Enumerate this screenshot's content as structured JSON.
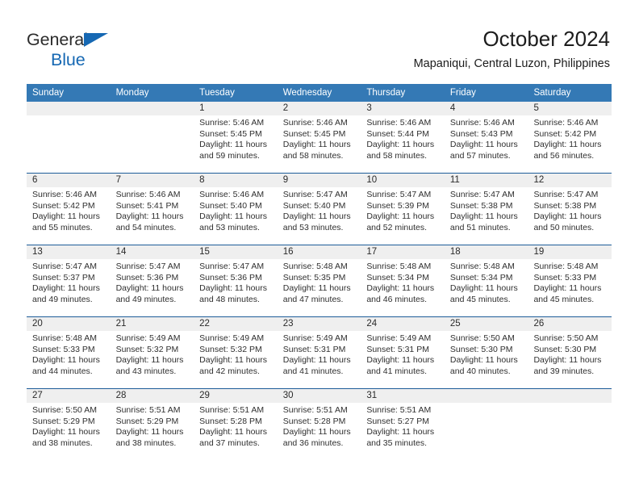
{
  "brand": {
    "word1": "General",
    "word2": "Blue",
    "triangle_color": "#1668b3",
    "text_color": "#2b2b2b"
  },
  "header": {
    "title": "October 2024",
    "subtitle": "Mapaniqui, Central Luzon, Philippines"
  },
  "theme": {
    "header_blue": "#3479b5",
    "divider_blue": "#1d5d99",
    "daynum_band": "#efefef",
    "cell_bg": "#ffffff"
  },
  "weekdays": [
    "Sunday",
    "Monday",
    "Tuesday",
    "Wednesday",
    "Thursday",
    "Friday",
    "Saturday"
  ],
  "weeks": [
    [
      {
        "day": "",
        "sunrise": "",
        "sunset": "",
        "daylight1": "",
        "daylight2": ""
      },
      {
        "day": "",
        "sunrise": "",
        "sunset": "",
        "daylight1": "",
        "daylight2": ""
      },
      {
        "day": "1",
        "sunrise": "Sunrise: 5:46 AM",
        "sunset": "Sunset: 5:45 PM",
        "daylight1": "Daylight: 11 hours",
        "daylight2": "and 59 minutes."
      },
      {
        "day": "2",
        "sunrise": "Sunrise: 5:46 AM",
        "sunset": "Sunset: 5:45 PM",
        "daylight1": "Daylight: 11 hours",
        "daylight2": "and 58 minutes."
      },
      {
        "day": "3",
        "sunrise": "Sunrise: 5:46 AM",
        "sunset": "Sunset: 5:44 PM",
        "daylight1": "Daylight: 11 hours",
        "daylight2": "and 58 minutes."
      },
      {
        "day": "4",
        "sunrise": "Sunrise: 5:46 AM",
        "sunset": "Sunset: 5:43 PM",
        "daylight1": "Daylight: 11 hours",
        "daylight2": "and 57 minutes."
      },
      {
        "day": "5",
        "sunrise": "Sunrise: 5:46 AM",
        "sunset": "Sunset: 5:42 PM",
        "daylight1": "Daylight: 11 hours",
        "daylight2": "and 56 minutes."
      }
    ],
    [
      {
        "day": "6",
        "sunrise": "Sunrise: 5:46 AM",
        "sunset": "Sunset: 5:42 PM",
        "daylight1": "Daylight: 11 hours",
        "daylight2": "and 55 minutes."
      },
      {
        "day": "7",
        "sunrise": "Sunrise: 5:46 AM",
        "sunset": "Sunset: 5:41 PM",
        "daylight1": "Daylight: 11 hours",
        "daylight2": "and 54 minutes."
      },
      {
        "day": "8",
        "sunrise": "Sunrise: 5:46 AM",
        "sunset": "Sunset: 5:40 PM",
        "daylight1": "Daylight: 11 hours",
        "daylight2": "and 53 minutes."
      },
      {
        "day": "9",
        "sunrise": "Sunrise: 5:47 AM",
        "sunset": "Sunset: 5:40 PM",
        "daylight1": "Daylight: 11 hours",
        "daylight2": "and 53 minutes."
      },
      {
        "day": "10",
        "sunrise": "Sunrise: 5:47 AM",
        "sunset": "Sunset: 5:39 PM",
        "daylight1": "Daylight: 11 hours",
        "daylight2": "and 52 minutes."
      },
      {
        "day": "11",
        "sunrise": "Sunrise: 5:47 AM",
        "sunset": "Sunset: 5:38 PM",
        "daylight1": "Daylight: 11 hours",
        "daylight2": "and 51 minutes."
      },
      {
        "day": "12",
        "sunrise": "Sunrise: 5:47 AM",
        "sunset": "Sunset: 5:38 PM",
        "daylight1": "Daylight: 11 hours",
        "daylight2": "and 50 minutes."
      }
    ],
    [
      {
        "day": "13",
        "sunrise": "Sunrise: 5:47 AM",
        "sunset": "Sunset: 5:37 PM",
        "daylight1": "Daylight: 11 hours",
        "daylight2": "and 49 minutes."
      },
      {
        "day": "14",
        "sunrise": "Sunrise: 5:47 AM",
        "sunset": "Sunset: 5:36 PM",
        "daylight1": "Daylight: 11 hours",
        "daylight2": "and 49 minutes."
      },
      {
        "day": "15",
        "sunrise": "Sunrise: 5:47 AM",
        "sunset": "Sunset: 5:36 PM",
        "daylight1": "Daylight: 11 hours",
        "daylight2": "and 48 minutes."
      },
      {
        "day": "16",
        "sunrise": "Sunrise: 5:48 AM",
        "sunset": "Sunset: 5:35 PM",
        "daylight1": "Daylight: 11 hours",
        "daylight2": "and 47 minutes."
      },
      {
        "day": "17",
        "sunrise": "Sunrise: 5:48 AM",
        "sunset": "Sunset: 5:34 PM",
        "daylight1": "Daylight: 11 hours",
        "daylight2": "and 46 minutes."
      },
      {
        "day": "18",
        "sunrise": "Sunrise: 5:48 AM",
        "sunset": "Sunset: 5:34 PM",
        "daylight1": "Daylight: 11 hours",
        "daylight2": "and 45 minutes."
      },
      {
        "day": "19",
        "sunrise": "Sunrise: 5:48 AM",
        "sunset": "Sunset: 5:33 PM",
        "daylight1": "Daylight: 11 hours",
        "daylight2": "and 45 minutes."
      }
    ],
    [
      {
        "day": "20",
        "sunrise": "Sunrise: 5:48 AM",
        "sunset": "Sunset: 5:33 PM",
        "daylight1": "Daylight: 11 hours",
        "daylight2": "and 44 minutes."
      },
      {
        "day": "21",
        "sunrise": "Sunrise: 5:49 AM",
        "sunset": "Sunset: 5:32 PM",
        "daylight1": "Daylight: 11 hours",
        "daylight2": "and 43 minutes."
      },
      {
        "day": "22",
        "sunrise": "Sunrise: 5:49 AM",
        "sunset": "Sunset: 5:32 PM",
        "daylight1": "Daylight: 11 hours",
        "daylight2": "and 42 minutes."
      },
      {
        "day": "23",
        "sunrise": "Sunrise: 5:49 AM",
        "sunset": "Sunset: 5:31 PM",
        "daylight1": "Daylight: 11 hours",
        "daylight2": "and 41 minutes."
      },
      {
        "day": "24",
        "sunrise": "Sunrise: 5:49 AM",
        "sunset": "Sunset: 5:31 PM",
        "daylight1": "Daylight: 11 hours",
        "daylight2": "and 41 minutes."
      },
      {
        "day": "25",
        "sunrise": "Sunrise: 5:50 AM",
        "sunset": "Sunset: 5:30 PM",
        "daylight1": "Daylight: 11 hours",
        "daylight2": "and 40 minutes."
      },
      {
        "day": "26",
        "sunrise": "Sunrise: 5:50 AM",
        "sunset": "Sunset: 5:30 PM",
        "daylight1": "Daylight: 11 hours",
        "daylight2": "and 39 minutes."
      }
    ],
    [
      {
        "day": "27",
        "sunrise": "Sunrise: 5:50 AM",
        "sunset": "Sunset: 5:29 PM",
        "daylight1": "Daylight: 11 hours",
        "daylight2": "and 38 minutes."
      },
      {
        "day": "28",
        "sunrise": "Sunrise: 5:51 AM",
        "sunset": "Sunset: 5:29 PM",
        "daylight1": "Daylight: 11 hours",
        "daylight2": "and 38 minutes."
      },
      {
        "day": "29",
        "sunrise": "Sunrise: 5:51 AM",
        "sunset": "Sunset: 5:28 PM",
        "daylight1": "Daylight: 11 hours",
        "daylight2": "and 37 minutes."
      },
      {
        "day": "30",
        "sunrise": "Sunrise: 5:51 AM",
        "sunset": "Sunset: 5:28 PM",
        "daylight1": "Daylight: 11 hours",
        "daylight2": "and 36 minutes."
      },
      {
        "day": "31",
        "sunrise": "Sunrise: 5:51 AM",
        "sunset": "Sunset: 5:27 PM",
        "daylight1": "Daylight: 11 hours",
        "daylight2": "and 35 minutes."
      },
      {
        "day": "",
        "sunrise": "",
        "sunset": "",
        "daylight1": "",
        "daylight2": ""
      },
      {
        "day": "",
        "sunrise": "",
        "sunset": "",
        "daylight1": "",
        "daylight2": ""
      }
    ]
  ]
}
